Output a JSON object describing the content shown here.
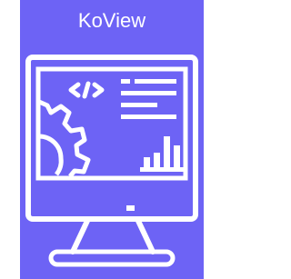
{
  "app": {
    "title": "KoView",
    "icon": "monitor-dashboard-icon",
    "colors": {
      "background": "#6d63f5",
      "foreground": "#ffffff",
      "page": "#ffffff"
    }
  }
}
